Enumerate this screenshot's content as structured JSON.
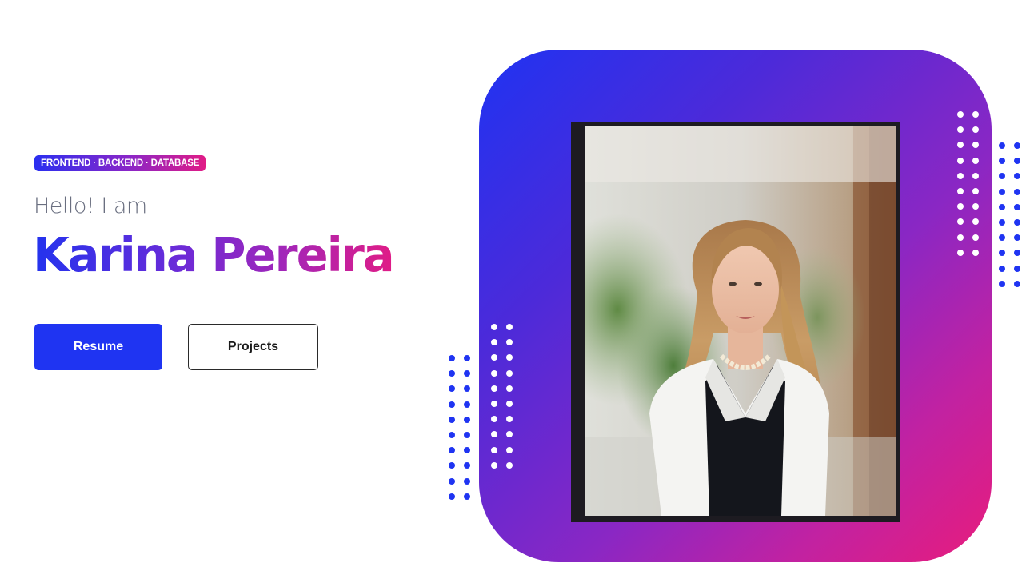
{
  "hero": {
    "badge": "FRONTEND · BACKEND · DATABASE",
    "greeting": "Hello! I am",
    "name": "Karina Pereira",
    "buttons": {
      "resume": "Resume",
      "projects": "Projects"
    }
  },
  "colors": {
    "accent_blue": "#1f34f2",
    "accent_purple": "#8a27c4",
    "accent_pink": "#e81c7c"
  },
  "profile_image": {
    "icon": "profile-photo"
  }
}
